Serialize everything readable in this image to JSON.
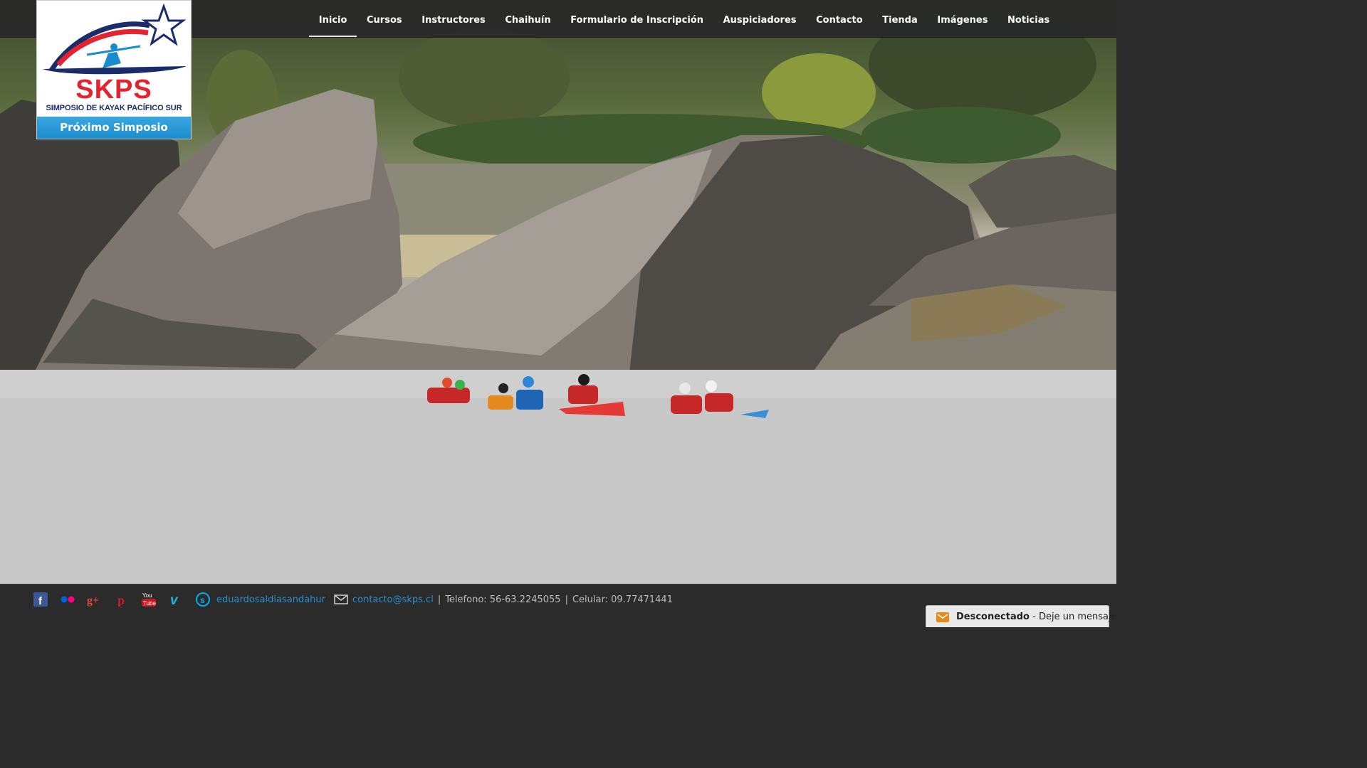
{
  "nav": {
    "items": [
      {
        "label": "Inicio",
        "active": true
      },
      {
        "label": "Cursos"
      },
      {
        "label": "Instructores"
      },
      {
        "label": "Chaihuín"
      },
      {
        "label": "Formulario de Inscripción"
      },
      {
        "label": "Auspiciadores"
      },
      {
        "label": "Contacto"
      },
      {
        "label": "Tienda"
      },
      {
        "label": "Imágenes"
      },
      {
        "label": "Noticias"
      }
    ]
  },
  "logo": {
    "wordmark": "SKPS",
    "caption": "SIMPOSIO DE KAYAK PACÍFICO SUR",
    "button_label": "Próximo Simposio"
  },
  "footer": {
    "social_icons": [
      "facebook-icon",
      "flickr-icon",
      "google-plus-icon",
      "pinterest-icon",
      "youtube-icon",
      "vimeo-icon",
      "skype-icon"
    ],
    "skype_user": "eduardosaldiasandahur",
    "email": "contacto@skps.cl",
    "phone": "Telefono: 56-63.2245055",
    "mobile": "Celular: 09.77471441",
    "separator": "|"
  },
  "chat": {
    "status": "Desconectado",
    "dash": "-",
    "message": "Deje un mensaje"
  },
  "colors": {
    "nav_bg": "#282828",
    "link": "#2a8fd0",
    "logo_red": "#e52330",
    "logo_blue": "#1b2c6b",
    "button_blue": "#1a8ccd"
  }
}
